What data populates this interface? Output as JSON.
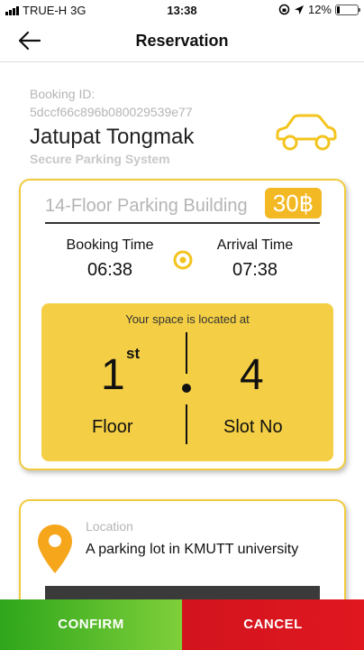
{
  "status_bar": {
    "carrier": "TRUE-H",
    "network": "3G",
    "time": "13:38",
    "battery": "12%"
  },
  "header": {
    "title": "Reservation",
    "back_icon": "arrow-left-icon"
  },
  "booking": {
    "id_label": "Booking ID:",
    "id_value": "5dccf66c896b080029539e77",
    "user_name": "Jatupat Tongmak",
    "system_name": "Secure Parking System",
    "car_icon": "car-icon"
  },
  "reservation": {
    "building": "14-Floor Parking Building",
    "price": "30฿",
    "booking_time_label": "Booking Time",
    "booking_time": "06:38",
    "arrival_time_label": "Arrival Time",
    "arrival_time": "07:38",
    "space_caption": "Your space is located at",
    "floor_number": "1",
    "floor_suffix": "st",
    "slot_number": "4",
    "floor_label": "Floor",
    "slot_label": "Slot No"
  },
  "location": {
    "label": "Location",
    "value": "A parking lot in KMUTT university",
    "icon": "map-pin-icon"
  },
  "actions": {
    "confirm": "CONFIRM",
    "cancel": "CANCEL"
  },
  "colors": {
    "accent_yellow": "#f4cf45",
    "card_border": "#f1cb3d",
    "price_badge": "#f3b924",
    "confirm_green": "#2ea61b",
    "cancel_red": "#d2141e"
  }
}
